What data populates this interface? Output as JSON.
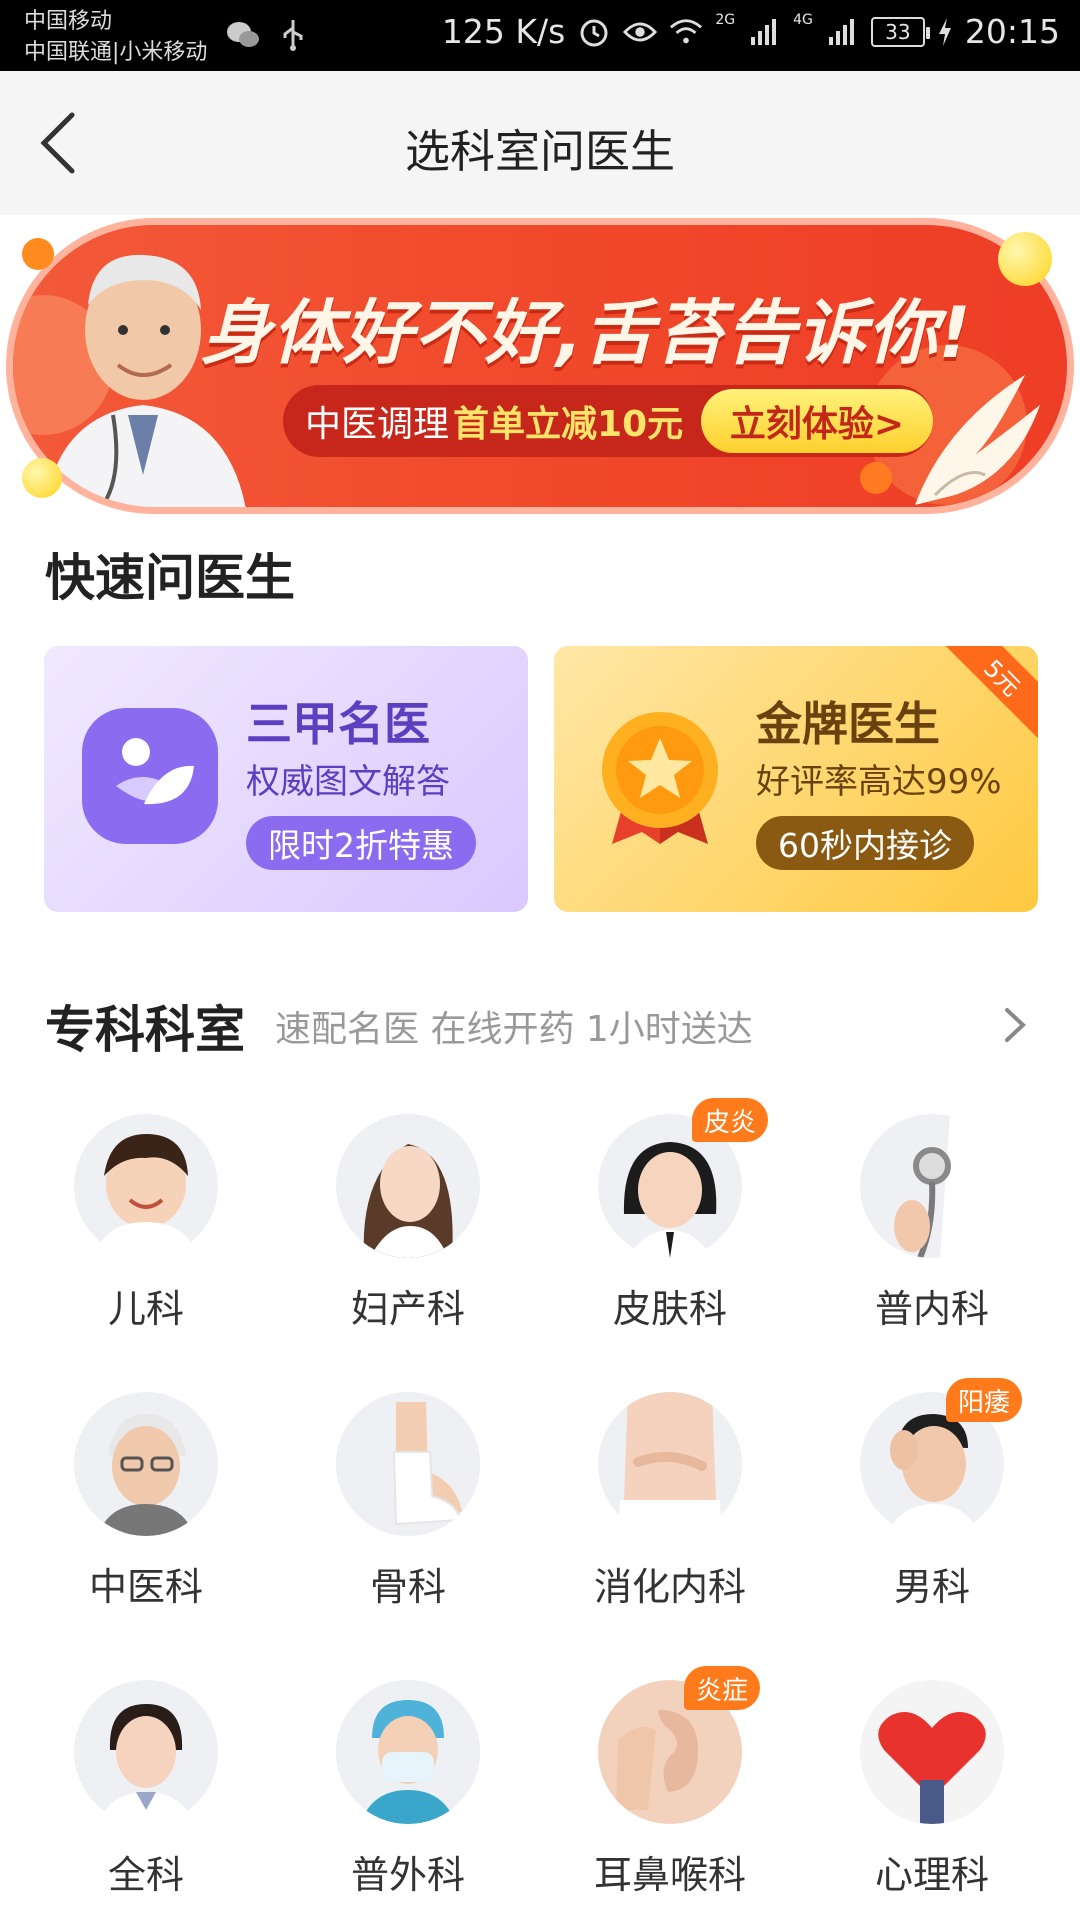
{
  "status_bar": {
    "carrier1": "中国移动",
    "carrier2": "中国联通|小米移动",
    "speed": "125 K/s",
    "signal1": "2G",
    "signal2": "4G",
    "battery": "33",
    "time": "20:15"
  },
  "nav": {
    "title": "选科室问医生"
  },
  "banner": {
    "headline": "身体好不好,舌苔告诉你!",
    "pill_text1": "中医调理",
    "pill_text2": "首单立减10元",
    "cta": "立刻体验>"
  },
  "quick": {
    "title": "快速问医生",
    "cards": [
      {
        "title": "三甲名医",
        "subtitle": "权威图文解答",
        "pill": "限时2折特惠"
      },
      {
        "title": "金牌医生",
        "subtitle": "好评率高达99%",
        "pill": "60秒内接诊",
        "corner": "5元"
      }
    ]
  },
  "specialty": {
    "title": "专科科室",
    "subtitle": "速配名医  在线开药  1小时送达",
    "departments": [
      {
        "label": "儿科"
      },
      {
        "label": "妇产科"
      },
      {
        "label": "皮肤科",
        "tag": "皮炎"
      },
      {
        "label": "普内科"
      },
      {
        "label": "中医科"
      },
      {
        "label": "骨科"
      },
      {
        "label": "消化内科"
      },
      {
        "label": "男科",
        "tag": "阳痿"
      },
      {
        "label": "全科"
      },
      {
        "label": "普外科"
      },
      {
        "label": "耳鼻喉科",
        "tag": "炎症"
      },
      {
        "label": "心理科"
      }
    ]
  },
  "colors": {
    "banner_red": "#ef4228",
    "accent_orange": "#ff7a1a",
    "purple": "#8b6cf0",
    "gold": "#ffc940"
  }
}
